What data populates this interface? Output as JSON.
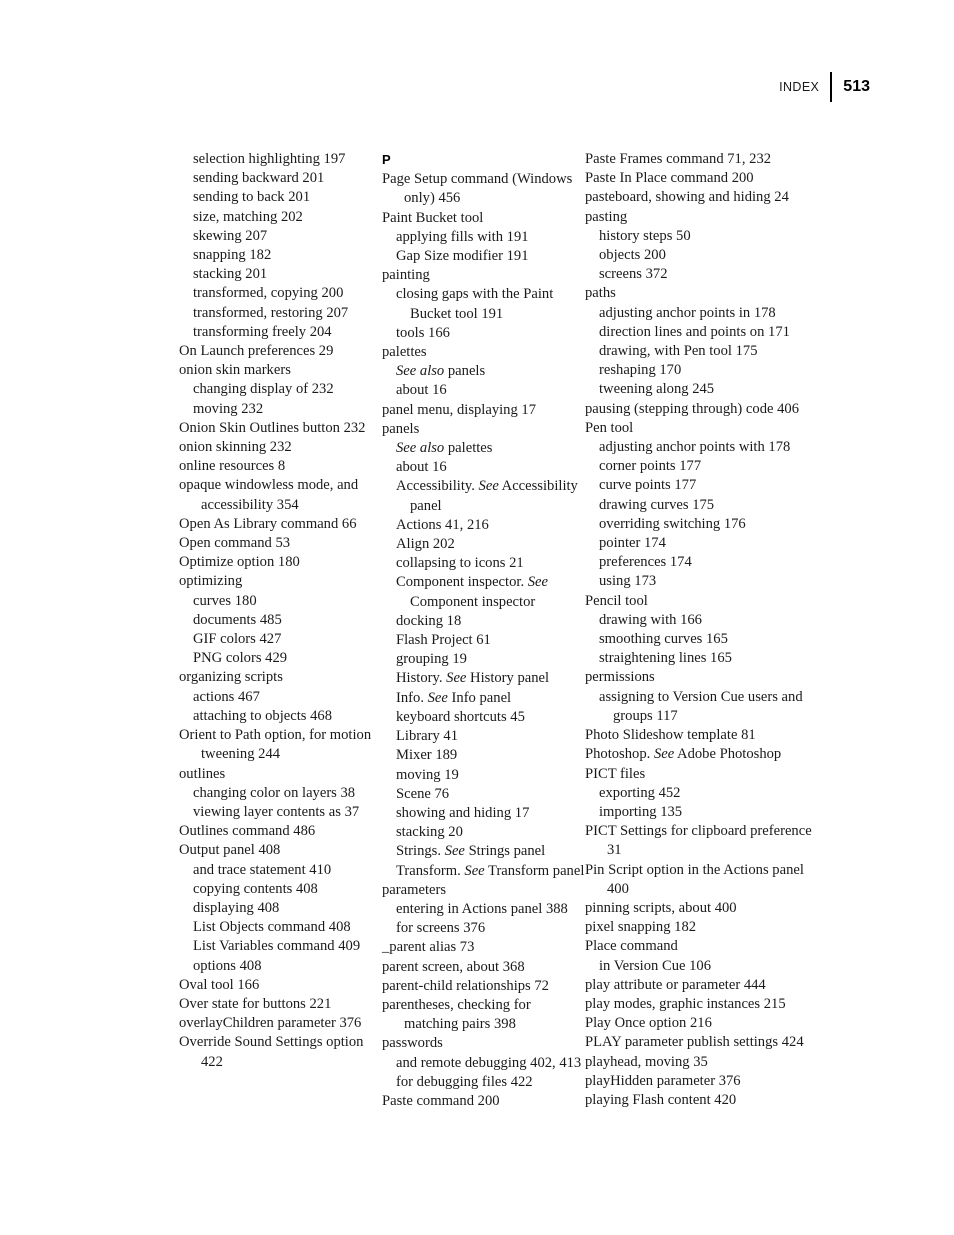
{
  "header": {
    "label": "INDEX",
    "folio": "513"
  },
  "columns": [
    {
      "name": "index-column-1",
      "entries": [
        {
          "level": 1,
          "text": "selection highlighting 197"
        },
        {
          "level": 1,
          "text": "sending backward 201"
        },
        {
          "level": 1,
          "text": "sending to back 201"
        },
        {
          "level": 1,
          "text": "size, matching 202"
        },
        {
          "level": 1,
          "text": "skewing 207"
        },
        {
          "level": 1,
          "text": "snapping 182"
        },
        {
          "level": 1,
          "text": "stacking 201"
        },
        {
          "level": 1,
          "text": "transformed, copying 200"
        },
        {
          "level": 1,
          "text": "transformed, restoring 207"
        },
        {
          "level": 1,
          "text": "transforming freely 204"
        },
        {
          "level": 0,
          "text": "On Launch preferences 29"
        },
        {
          "level": 0,
          "text": "onion skin markers"
        },
        {
          "level": 1,
          "text": "changing display of 232"
        },
        {
          "level": 1,
          "text": "moving 232"
        },
        {
          "level": 0,
          "text": "Onion Skin Outlines button 232"
        },
        {
          "level": 0,
          "text": "onion skinning 232"
        },
        {
          "level": 0,
          "text": "online resources 8"
        },
        {
          "level": 0,
          "text": "opaque windowless mode, and accessibility 354"
        },
        {
          "level": 0,
          "text": "Open As Library command 66"
        },
        {
          "level": 0,
          "text": "Open command 53"
        },
        {
          "level": 0,
          "text": "Optimize option 180"
        },
        {
          "level": 0,
          "text": "optimizing"
        },
        {
          "level": 1,
          "text": "curves 180"
        },
        {
          "level": 1,
          "text": "documents 485"
        },
        {
          "level": 1,
          "text": "GIF colors 427"
        },
        {
          "level": 1,
          "text": "PNG colors 429"
        },
        {
          "level": 0,
          "text": "organizing scripts"
        },
        {
          "level": 1,
          "text": "actions 467"
        },
        {
          "level": 1,
          "text": "attaching to objects 468"
        },
        {
          "level": 0,
          "text": "Orient to Path option, for motion tweening 244"
        },
        {
          "level": 0,
          "text": "outlines"
        },
        {
          "level": 1,
          "text": "changing color on layers 38"
        },
        {
          "level": 1,
          "text": "viewing layer contents as 37"
        },
        {
          "level": 0,
          "text": "Outlines command 486"
        },
        {
          "level": 0,
          "text": "Output panel 408"
        },
        {
          "level": 1,
          "text": "and trace statement 410"
        },
        {
          "level": 1,
          "text": "copying contents 408"
        },
        {
          "level": 1,
          "text": "displaying 408"
        },
        {
          "level": 1,
          "text": "List Objects command 408"
        },
        {
          "level": 1,
          "text": "List Variables command 409"
        },
        {
          "level": 1,
          "text": "options 408"
        },
        {
          "level": 0,
          "text": "Oval tool 166"
        },
        {
          "level": 0,
          "text": "Over state for buttons 221"
        },
        {
          "level": 0,
          "text": "overlayChildren parameter 376"
        },
        {
          "level": 0,
          "text": "Override Sound Settings option 422"
        }
      ]
    },
    {
      "name": "index-column-2",
      "letter": "P",
      "entries": [
        {
          "level": 0,
          "text": "Page Setup command (Windows only) 456"
        },
        {
          "level": 0,
          "text": "Paint Bucket tool"
        },
        {
          "level": 1,
          "text": "applying fills with 191"
        },
        {
          "level": 1,
          "text": "Gap Size modifier 191"
        },
        {
          "level": 0,
          "text": "painting"
        },
        {
          "level": 1,
          "text": "closing gaps with the Paint Bucket tool 191"
        },
        {
          "level": 1,
          "text": "tools 166"
        },
        {
          "level": 0,
          "text": "palettes"
        },
        {
          "level": 1,
          "html": "<i>See also</i> panels"
        },
        {
          "level": 1,
          "text": "about 16"
        },
        {
          "level": 0,
          "text": "panel menu, displaying 17"
        },
        {
          "level": 0,
          "text": "panels"
        },
        {
          "level": 1,
          "html": "<i>See also</i> palettes"
        },
        {
          "level": 1,
          "text": "about 16"
        },
        {
          "level": 1,
          "html": "Accessibility. <i>See</i> Accessibility panel"
        },
        {
          "level": 1,
          "text": "Actions 41, 216"
        },
        {
          "level": 1,
          "text": "Align 202"
        },
        {
          "level": 1,
          "text": "collapsing to icons 21"
        },
        {
          "level": 1,
          "html": "Component inspector. <i>See</i> Component inspector"
        },
        {
          "level": 1,
          "text": "docking 18"
        },
        {
          "level": 1,
          "text": "Flash Project 61"
        },
        {
          "level": 1,
          "text": "grouping 19"
        },
        {
          "level": 1,
          "html": "History. <i>See</i> History panel"
        },
        {
          "level": 1,
          "html": "Info. <i>See</i> Info panel"
        },
        {
          "level": 1,
          "text": "keyboard shortcuts 45"
        },
        {
          "level": 1,
          "text": "Library 41"
        },
        {
          "level": 1,
          "text": "Mixer 189"
        },
        {
          "level": 1,
          "text": "moving 19"
        },
        {
          "level": 1,
          "text": "Scene 76"
        },
        {
          "level": 1,
          "text": "showing and hiding 17"
        },
        {
          "level": 1,
          "text": "stacking 20"
        },
        {
          "level": 1,
          "html": "Strings. <i>See</i> Strings panel"
        },
        {
          "level": 1,
          "html": "Transform. <i>See</i> Transform panel"
        },
        {
          "level": 0,
          "text": "parameters"
        },
        {
          "level": 1,
          "text": "entering in Actions panel 388"
        },
        {
          "level": 1,
          "text": "for screens 376"
        },
        {
          "level": 0,
          "text": "_parent alias 73"
        },
        {
          "level": 0,
          "text": "parent screen, about 368"
        },
        {
          "level": 0,
          "text": "parent-child relationships 72"
        },
        {
          "level": 0,
          "text": "parentheses, checking for matching pairs 398"
        },
        {
          "level": 0,
          "text": "passwords"
        },
        {
          "level": 1,
          "text": "and remote debugging 402, 413"
        },
        {
          "level": 1,
          "text": "for debugging files 422"
        },
        {
          "level": 0,
          "text": "Paste command 200"
        }
      ]
    },
    {
      "name": "index-column-3",
      "entries": [
        {
          "level": 0,
          "text": "Paste Frames command 71, 232"
        },
        {
          "level": 0,
          "text": "Paste In Place command 200"
        },
        {
          "level": 0,
          "text": "pasteboard, showing and hiding 24"
        },
        {
          "level": 0,
          "text": "pasting"
        },
        {
          "level": 1,
          "text": "history steps 50"
        },
        {
          "level": 1,
          "text": "objects 200"
        },
        {
          "level": 1,
          "text": "screens 372"
        },
        {
          "level": 0,
          "text": "paths"
        },
        {
          "level": 1,
          "text": "adjusting anchor points in 178"
        },
        {
          "level": 1,
          "text": "direction lines and points on 171"
        },
        {
          "level": 1,
          "text": "drawing, with Pen tool 175"
        },
        {
          "level": 1,
          "text": "reshaping 170"
        },
        {
          "level": 1,
          "text": "tweening along 245"
        },
        {
          "level": 0,
          "text": "pausing (stepping through) code 406"
        },
        {
          "level": 0,
          "text": "Pen tool"
        },
        {
          "level": 1,
          "text": "adjusting anchor points with 178"
        },
        {
          "level": 1,
          "text": "corner points 177"
        },
        {
          "level": 1,
          "text": "curve points 177"
        },
        {
          "level": 1,
          "text": "drawing curves 175"
        },
        {
          "level": 1,
          "text": "overriding switching 176"
        },
        {
          "level": 1,
          "text": "pointer 174"
        },
        {
          "level": 1,
          "text": "preferences 174"
        },
        {
          "level": 1,
          "text": "using 173"
        },
        {
          "level": 0,
          "text": "Pencil tool"
        },
        {
          "level": 1,
          "text": "drawing with 166"
        },
        {
          "level": 1,
          "text": "smoothing curves 165"
        },
        {
          "level": 1,
          "text": "straightening lines 165"
        },
        {
          "level": 0,
          "text": "permissions"
        },
        {
          "level": 1,
          "text": "assigning to Version Cue users and groups 117"
        },
        {
          "level": 0,
          "text": "Photo Slideshow template 81"
        },
        {
          "level": 0,
          "html": "Photoshop. <i>See</i> Adobe Photoshop"
        },
        {
          "level": 0,
          "text": "PICT files"
        },
        {
          "level": 1,
          "text": "exporting 452"
        },
        {
          "level": 1,
          "text": "importing 135"
        },
        {
          "level": 0,
          "text": "PICT Settings for clipboard preference 31"
        },
        {
          "level": 0,
          "text": "Pin Script option in the Actions panel 400"
        },
        {
          "level": 0,
          "text": "pinning scripts, about 400"
        },
        {
          "level": 0,
          "text": "pixel snapping 182"
        },
        {
          "level": 0,
          "text": "Place command"
        },
        {
          "level": 1,
          "text": "in Version Cue 106"
        },
        {
          "level": 0,
          "text": "play attribute or parameter 444"
        },
        {
          "level": 0,
          "text": "play modes, graphic instances 215"
        },
        {
          "level": 0,
          "text": "Play Once option 216"
        },
        {
          "level": 0,
          "text": "PLAY parameter publish settings 424"
        },
        {
          "level": 0,
          "text": "playhead, moving 35"
        },
        {
          "level": 0,
          "text": "playHidden parameter 376"
        },
        {
          "level": 0,
          "text": "playing Flash content 420"
        }
      ]
    }
  ]
}
